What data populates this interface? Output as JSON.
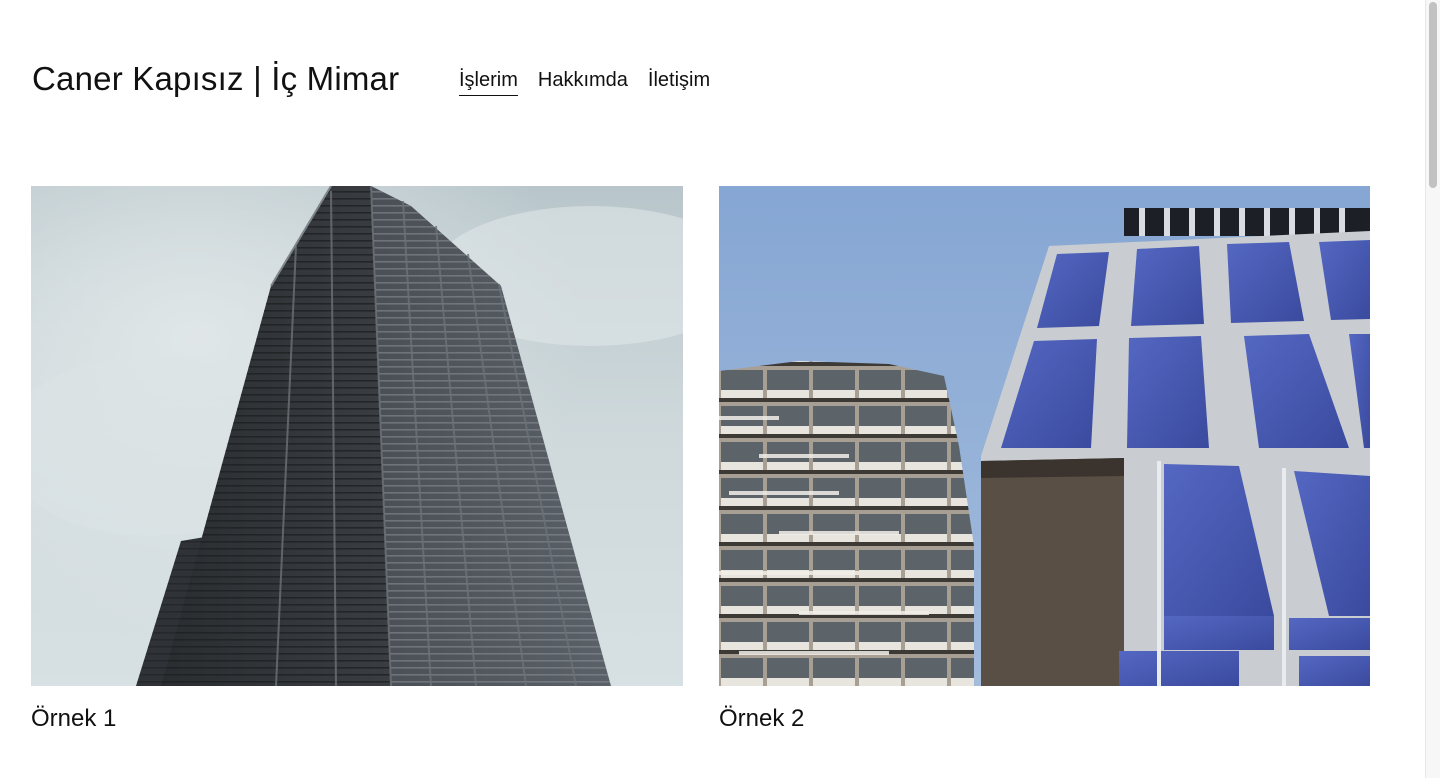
{
  "header": {
    "site_title": "Caner Kapısız | İç Mimar"
  },
  "nav": {
    "items": [
      {
        "label": "İşlerim",
        "active": true
      },
      {
        "label": "Hakkımda",
        "active": false
      },
      {
        "label": "İletişim",
        "active": false
      }
    ]
  },
  "gallery": {
    "items": [
      {
        "caption": "Örnek 1",
        "image": "building-dark-tower-photo"
      },
      {
        "caption": "Örnek 2",
        "image": "building-blue-glass-facade-photo"
      }
    ]
  },
  "colors": {
    "text": "#111111",
    "background": "#ffffff",
    "sky_grey": "#c9d3d7",
    "sky_blue": "#8eaed5",
    "glass_blue": "#4a5fb4"
  }
}
